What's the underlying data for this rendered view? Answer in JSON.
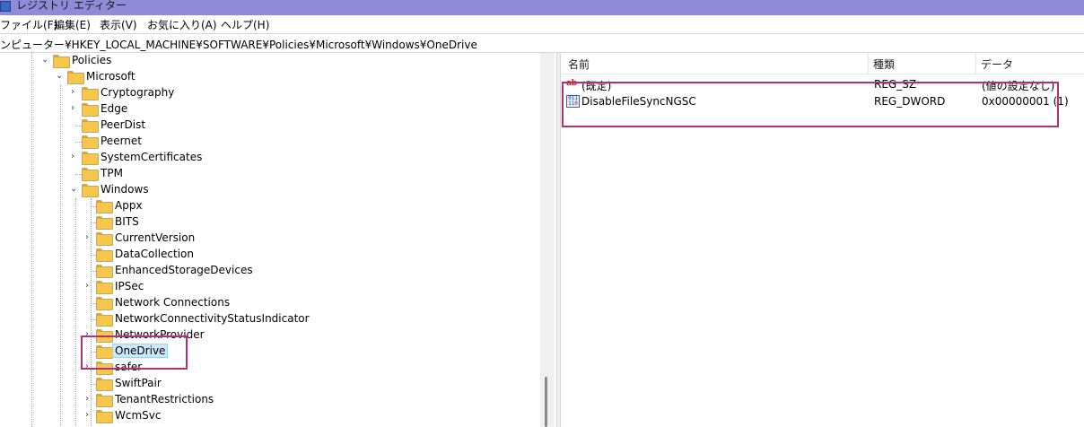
{
  "window": {
    "title": "レジストリ エディター"
  },
  "menu": [
    "ファイル(F)",
    "編集(E)",
    "表示(V)",
    "お気に入り(A)",
    "ヘルプ(H)"
  ],
  "address": {
    "path": "ンピューター¥HKEY_LOCAL_MACHINE¥SOFTWARE¥Policies¥Microsoft¥Windows¥OneDrive"
  },
  "tree": {
    "policies": "Policies",
    "microsoft": "Microsoft",
    "cryptography": "Cryptography",
    "edge": "Edge",
    "peerdist": "PeerDist",
    "peernet": "Peernet",
    "systemcertificates": "SystemCertificates",
    "tpm": "TPM",
    "windows": "Windows",
    "appx": "Appx",
    "bits": "BITS",
    "currentversion": "CurrentVersion",
    "datacollection": "DataCollection",
    "enhancedstorage": "EnhancedStorageDevices",
    "ipsec": "IPSec",
    "networkconnections": "Network Connections",
    "ncsi": "NetworkConnectivityStatusIndicator",
    "networkprovider": "NetworkProvider",
    "onedrive": "OneDrive",
    "safer": "safer",
    "swiftpair": "SwiftPair",
    "tenantrestrictions": "TenantRestrictions",
    "wcmsvc": "WcmSvc"
  },
  "list": {
    "headers": {
      "name": "名前",
      "type": "種類",
      "data": "データ"
    },
    "rows": [
      {
        "name": "(既定)",
        "type": "REG_SZ",
        "data": "(値の設定なし)",
        "icon": "string-value-icon"
      },
      {
        "name": "DisableFileSyncNGSC",
        "type": "REG_DWORD",
        "data": "0x00000001 (1)",
        "icon": "dword-value-icon"
      }
    ]
  },
  "icons": {
    "string_glyph": "ab",
    "binary_glyph": "011\n110"
  },
  "colors": {
    "titlebar": "#8f8bd6",
    "highlight_box": "#b0307a",
    "selection": "#cce8ff",
    "folder": "#f6c74b"
  }
}
